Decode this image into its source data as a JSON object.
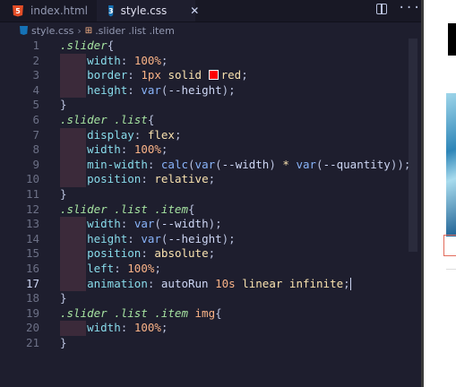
{
  "tabs": [
    {
      "name": "index.html",
      "icon": "html5-icon",
      "active": false
    },
    {
      "name": "style.css",
      "icon": "css3-icon",
      "active": true
    }
  ],
  "breadcrumb": {
    "file": "style.css",
    "path": ".slider .list .item"
  },
  "editor": {
    "active_line": 17,
    "lines": [
      {
        "n": "1",
        "t": ".slider{"
      },
      {
        "n": "2",
        "t": "    width: 100%;"
      },
      {
        "n": "3",
        "t": "    border: 1px solid red;"
      },
      {
        "n": "4",
        "t": "    height: var(--height);"
      },
      {
        "n": "5",
        "t": "}"
      },
      {
        "n": "6",
        "t": ".slider .list{"
      },
      {
        "n": "7",
        "t": "    display: flex;"
      },
      {
        "n": "8",
        "t": "    width: 100%;"
      },
      {
        "n": "9",
        "t": "    min-width: calc(var(--width) * var(--quantity));"
      },
      {
        "n": "10",
        "t": "    position: relative;"
      },
      {
        "n": "11",
        "t": "}"
      },
      {
        "n": "12",
        "t": ".slider .list .item{"
      },
      {
        "n": "13",
        "t": "    width: var(--width);"
      },
      {
        "n": "14",
        "t": "    height: var(--height);"
      },
      {
        "n": "15",
        "t": "    position: absolute;"
      },
      {
        "n": "16",
        "t": "    left: 100%;"
      },
      {
        "n": "17",
        "t": "    animation: autoRun 10s linear infinite;"
      },
      {
        "n": "18",
        "t": "}"
      },
      {
        "n": "19",
        "t": ".slider .list .item img{"
      },
      {
        "n": "20",
        "t": "    width: 100%;"
      },
      {
        "n": "21",
        "t": "}"
      }
    ]
  },
  "colors": {
    "background": "#1e1e2e",
    "selector": "#a6e3a1",
    "property": "#89dceb",
    "number": "#fab387",
    "swatch_red": "#ff0000"
  }
}
